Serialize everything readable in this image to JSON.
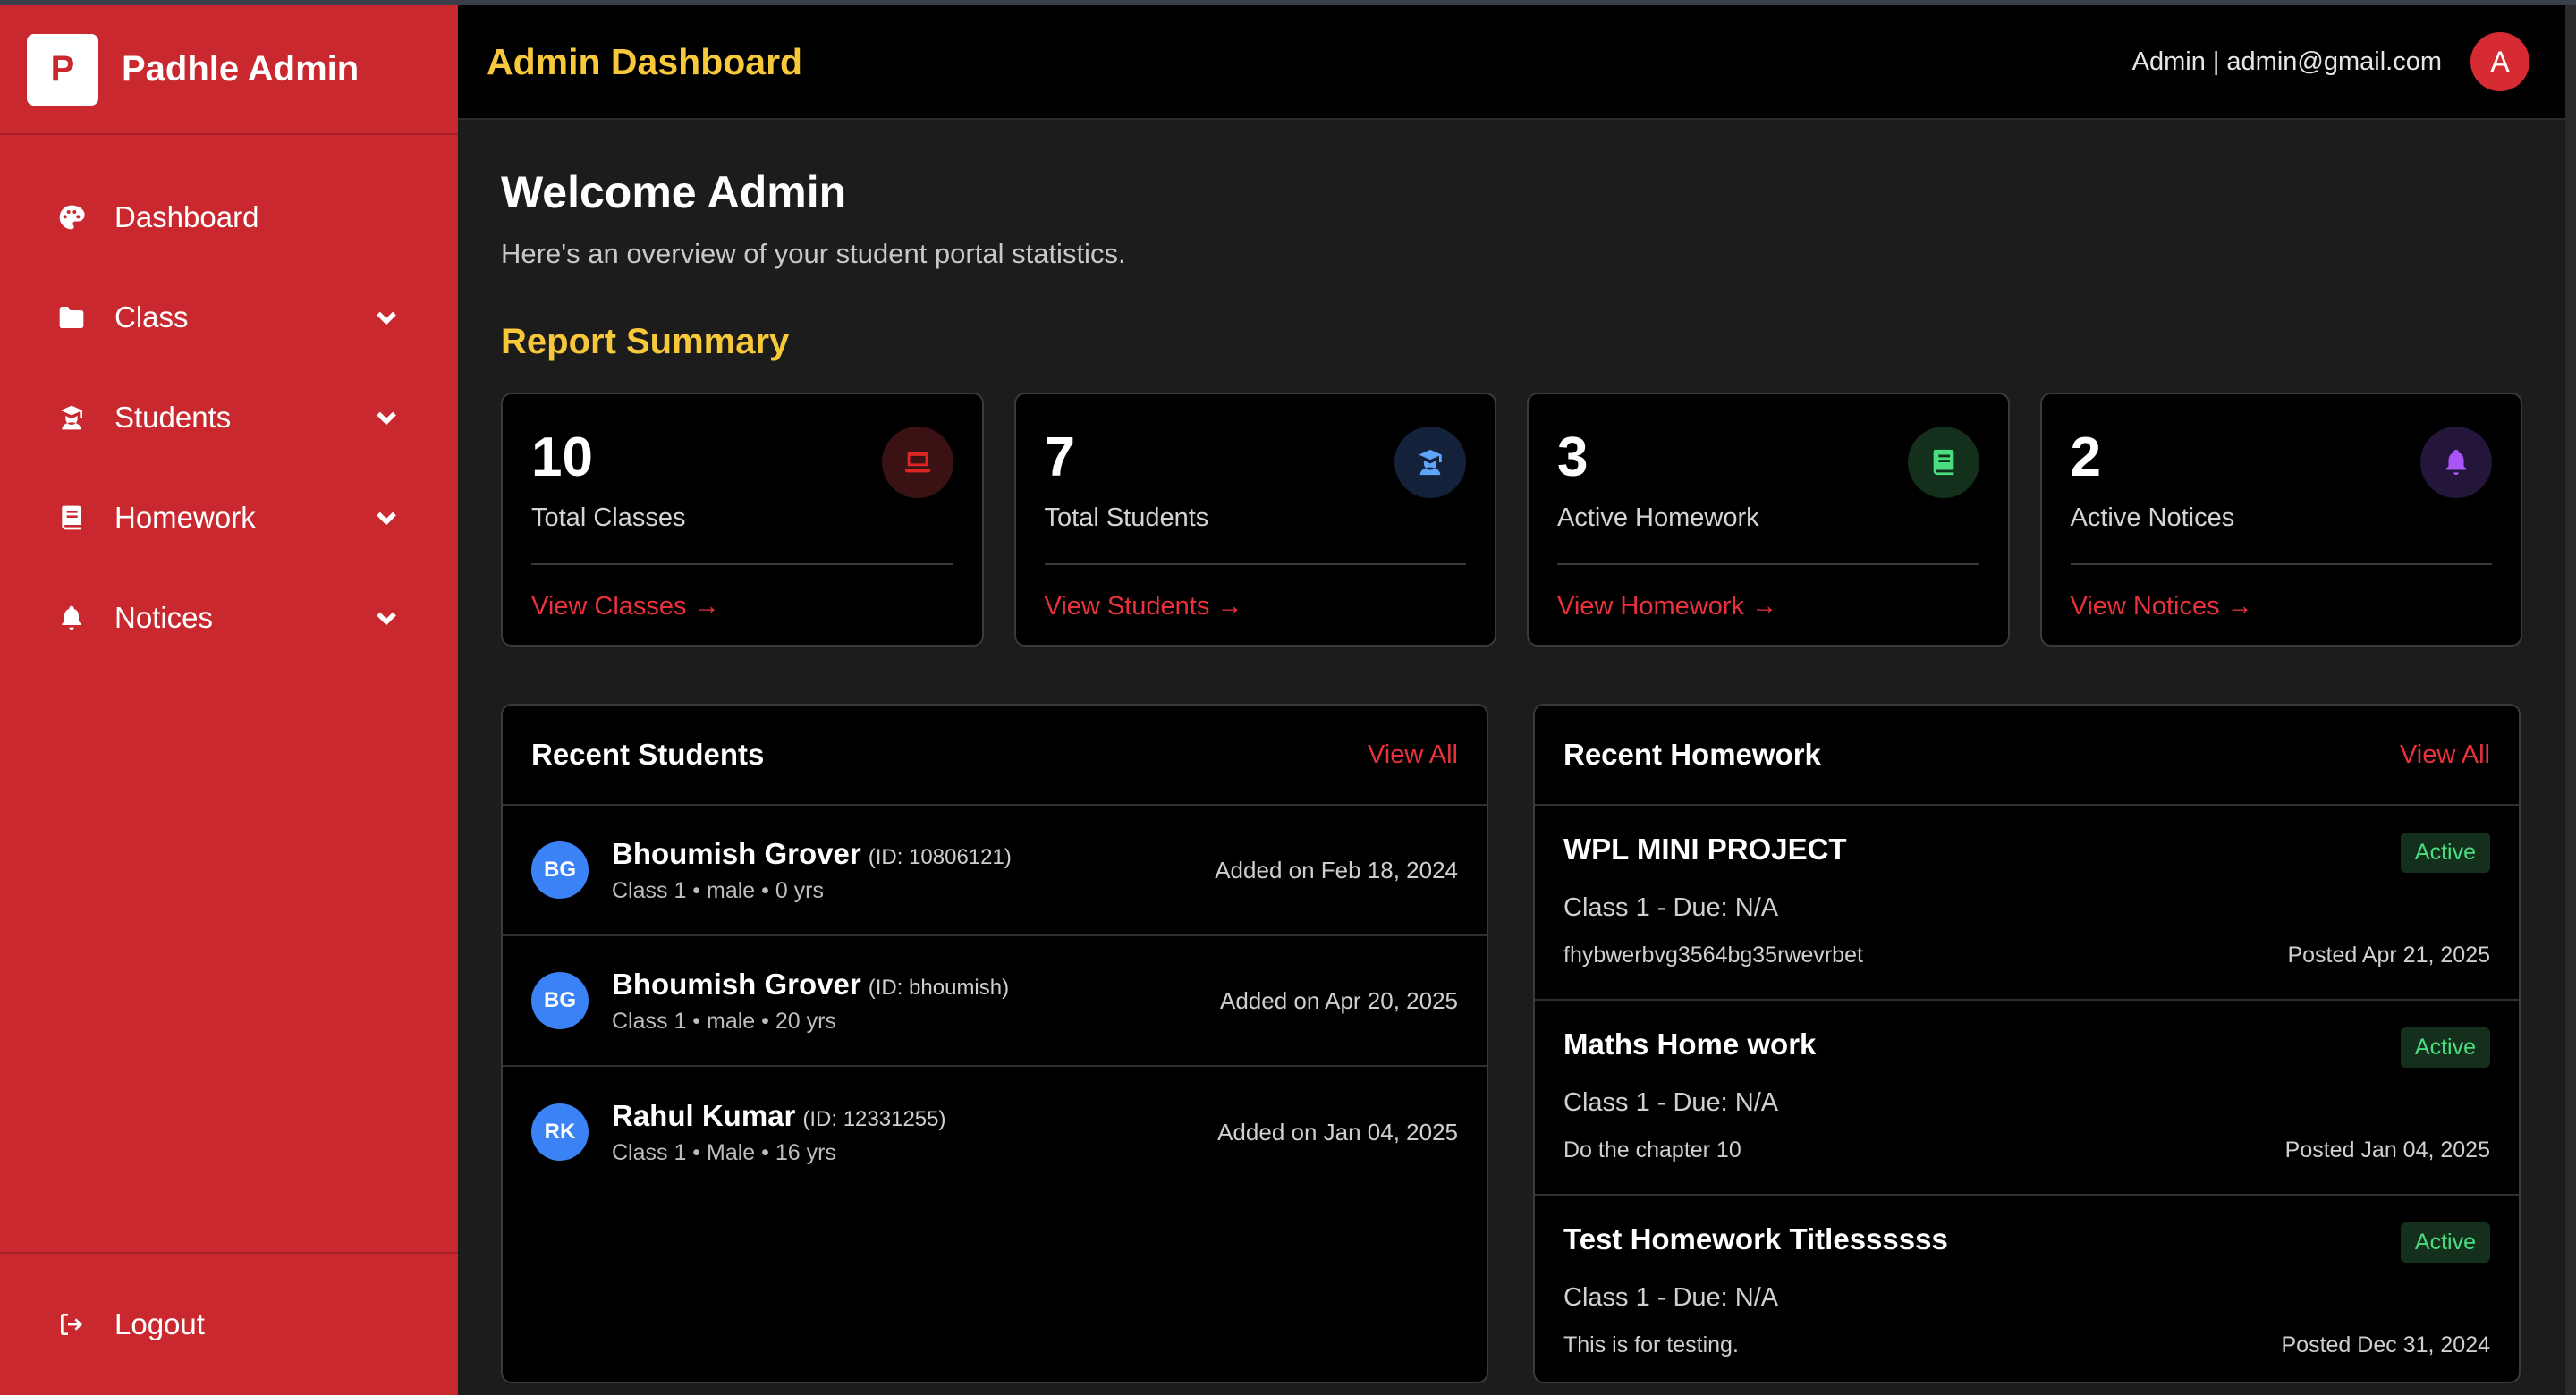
{
  "sidebar": {
    "logo_letter": "P",
    "brand": "Padhle Admin",
    "items": [
      {
        "label": "Dashboard",
        "icon": "palette-icon",
        "has_dropdown": false
      },
      {
        "label": "Class",
        "icon": "folder-icon",
        "has_dropdown": true
      },
      {
        "label": "Students",
        "icon": "student-icon",
        "has_dropdown": true
      },
      {
        "label": "Homework",
        "icon": "book-icon",
        "has_dropdown": true
      },
      {
        "label": "Notices",
        "icon": "bell-icon",
        "has_dropdown": true
      }
    ],
    "logout_label": "Logout"
  },
  "header": {
    "title": "Admin Dashboard",
    "user_role": "Admin",
    "separator": "|",
    "user_email": "admin@gmail.com",
    "avatar_letter": "A"
  },
  "main": {
    "welcome": "Welcome Admin",
    "subtitle": "Here's an overview of your student portal statistics.",
    "report_title": "Report Summary"
  },
  "stats": [
    {
      "value": "10",
      "label": "Total Classes",
      "link": "View Classes →",
      "icon": "laptop-icon",
      "icon_color": "#dc2626",
      "icon_bg": "#3a1214"
    },
    {
      "value": "7",
      "label": "Total Students",
      "link": "View Students →",
      "icon": "student-icon",
      "icon_color": "#60a5fa",
      "icon_bg": "#14213a"
    },
    {
      "value": "3",
      "label": "Active Homework",
      "link": "View Homework →",
      "icon": "book-icon",
      "icon_color": "#4ade80",
      "icon_bg": "#12301c"
    },
    {
      "value": "2",
      "label": "Active Notices",
      "link": "View Notices →",
      "icon": "bell-icon",
      "icon_color": "#a855f7",
      "icon_bg": "#24153a"
    }
  ],
  "recent_students": {
    "title": "Recent Students",
    "view_all": "View All",
    "rows": [
      {
        "initials": "BG",
        "name": "Bhoumish Grover",
        "id": "(ID: 10806121)",
        "meta": "Class 1 • male • 0 yrs",
        "added": "Added on Feb 18, 2024"
      },
      {
        "initials": "BG",
        "name": "Bhoumish Grover",
        "id": "(ID: bhoumish)",
        "meta": "Class 1 • male • 20 yrs",
        "added": "Added on Apr 20, 2025"
      },
      {
        "initials": "RK",
        "name": "Rahul Kumar",
        "id": "(ID: 12331255)",
        "meta": "Class 1 • Male • 16 yrs",
        "added": "Added on Jan 04, 2025"
      }
    ]
  },
  "recent_homework": {
    "title": "Recent Homework",
    "view_all": "View All",
    "rows": [
      {
        "title": "WPL MINI PROJECT",
        "status": "Active",
        "class_due": "Class 1 - Due: N/A",
        "desc": "fhybwerbvg3564bg35rwevrbet",
        "posted": "Posted Apr 21, 2025"
      },
      {
        "title": "Maths Home work",
        "status": "Active",
        "class_due": "Class 1 - Due: N/A",
        "desc": "Do the chapter 10",
        "posted": "Posted Jan 04, 2025"
      },
      {
        "title": "Test Homework Titlessssss",
        "status": "Active",
        "class_due": "Class 1 - Due: N/A",
        "desc": "This is for testing.",
        "posted": "Posted Dec 31, 2024"
      }
    ]
  },
  "colors": {
    "sidebar_bg": "#c9282f",
    "accent_yellow": "#f7c93a",
    "link_red": "#e8323b",
    "active_green": "#4ade80"
  }
}
